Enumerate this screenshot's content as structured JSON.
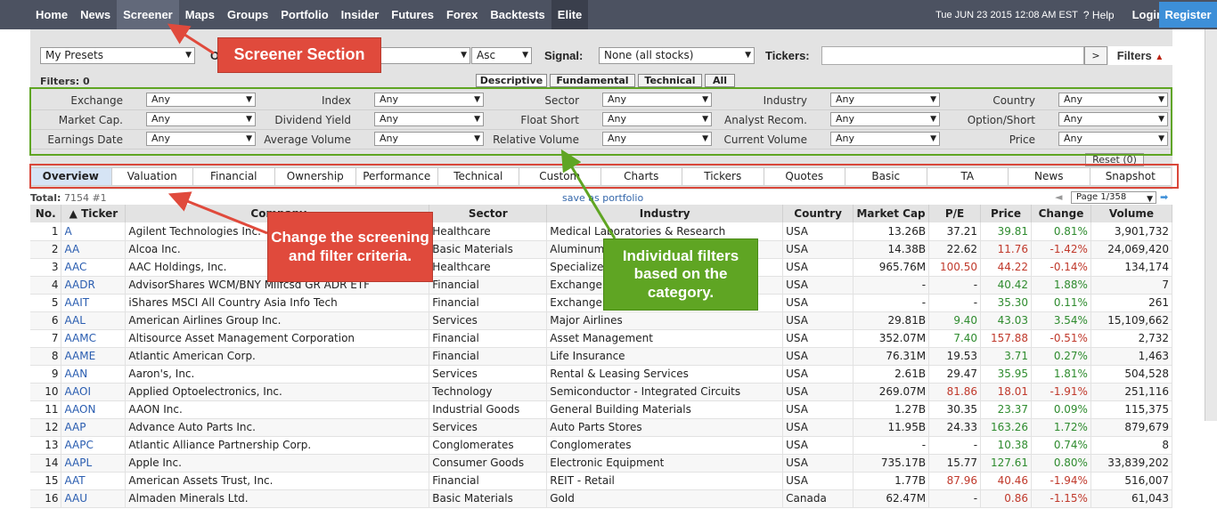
{
  "nav": {
    "items": [
      "Home",
      "News",
      "Screener",
      "Maps",
      "Groups",
      "Portfolio",
      "Insider",
      "Futures",
      "Forex",
      "Backtests",
      "Elite"
    ],
    "active": "Screener",
    "datetime": "Tue JUN 23 2015 12:08 AM EST",
    "help": "Help",
    "login": "Login",
    "register": "Register"
  },
  "controls": {
    "presets": "My Presets",
    "order_label": "O",
    "direction": "Asc",
    "signal_label": "Signal:",
    "signal": "None (all stocks)",
    "tickers_label": "Tickers:",
    "go": ">",
    "filters": "Filters"
  },
  "filters_count": "Filters: 0",
  "filter_tabs": [
    "Descriptive",
    "Fundamental",
    "Technical",
    "All"
  ],
  "filters": [
    {
      "label": "Exchange",
      "value": "Any"
    },
    {
      "label": "Index",
      "value": "Any"
    },
    {
      "label": "Sector",
      "value": "Any"
    },
    {
      "label": "Industry",
      "value": "Any"
    },
    {
      "label": "Country",
      "value": "Any"
    },
    {
      "label": "Market Cap.",
      "value": "Any"
    },
    {
      "label": "Dividend Yield",
      "value": "Any"
    },
    {
      "label": "Float Short",
      "value": "Any"
    },
    {
      "label": "Analyst Recom.",
      "value": "Any"
    },
    {
      "label": "Option/Short",
      "value": "Any"
    },
    {
      "label": "Earnings Date",
      "value": "Any"
    },
    {
      "label": "Average Volume",
      "value": "Any"
    },
    {
      "label": "Relative Volume",
      "value": "Any"
    },
    {
      "label": "Current Volume",
      "value": "Any"
    },
    {
      "label": "Price",
      "value": "Any"
    }
  ],
  "reset": "Reset (0)",
  "view_tabs": [
    "Overview",
    "Valuation",
    "Financial",
    "Ownership",
    "Performance",
    "Technical",
    "Custom",
    "Charts",
    "Tickers",
    "Quotes",
    "Basic",
    "TA",
    "News",
    "Snapshot"
  ],
  "total": {
    "label": "Total:",
    "value": "7154 #1"
  },
  "save_portfolio": "save as portfolio",
  "pager": {
    "prev": "◄",
    "page": "Page 1/358",
    "next": "➡"
  },
  "table": {
    "headers": [
      "No.",
      "▲ Ticker",
      "Company",
      "Sector",
      "Industry",
      "Country",
      "Market Cap",
      "P/E",
      "Price",
      "Change",
      "Volume"
    ],
    "rows": [
      [
        "1",
        "A",
        "Agilent Technologies Inc.",
        "Healthcare",
        "Medical Laboratories & Research",
        "USA",
        "13.26B",
        "37.21",
        "39.81",
        "0.81%",
        "3,901,732"
      ],
      [
        "2",
        "AA",
        "Alcoa Inc.",
        "Basic Materials",
        "Aluminum",
        "USA",
        "14.38B",
        "22.62",
        "11.76",
        "-1.42%",
        "24,069,420"
      ],
      [
        "3",
        "AAC",
        "AAC Holdings, Inc.",
        "Healthcare",
        "Specialized",
        "USA",
        "965.76M",
        "100.50",
        "44.22",
        "-0.14%",
        "134,174"
      ],
      [
        "4",
        "AADR",
        "AdvisorShares WCM/BNY Mllfcsd GR ADR ETF",
        "Financial",
        "Exchange T",
        "USA",
        "-",
        "-",
        "40.42",
        "1.88%",
        "7"
      ],
      [
        "5",
        "AAIT",
        "iShares MSCI All Country Asia Info Tech",
        "Financial",
        "Exchange T",
        "USA",
        "-",
        "-",
        "35.30",
        "0.11%",
        "261"
      ],
      [
        "6",
        "AAL",
        "American Airlines Group Inc.",
        "Services",
        "Major Airlines",
        "USA",
        "29.81B",
        "9.40",
        "43.03",
        "3.54%",
        "15,109,662"
      ],
      [
        "7",
        "AAMC",
        "Altisource Asset Management Corporation",
        "Financial",
        "Asset Management",
        "USA",
        "352.07M",
        "7.40",
        "157.88",
        "-0.51%",
        "2,732"
      ],
      [
        "8",
        "AAME",
        "Atlantic American Corp.",
        "Financial",
        "Life Insurance",
        "USA",
        "76.31M",
        "19.53",
        "3.71",
        "0.27%",
        "1,463"
      ],
      [
        "9",
        "AAN",
        "Aaron's, Inc.",
        "Services",
        "Rental & Leasing Services",
        "USA",
        "2.61B",
        "29.47",
        "35.95",
        "1.81%",
        "504,528"
      ],
      [
        "10",
        "AAOI",
        "Applied Optoelectronics, Inc.",
        "Technology",
        "Semiconductor - Integrated Circuits",
        "USA",
        "269.07M",
        "81.86",
        "18.01",
        "-1.91%",
        "251,116"
      ],
      [
        "11",
        "AAON",
        "AAON Inc.",
        "Industrial Goods",
        "General Building Materials",
        "USA",
        "1.27B",
        "30.35",
        "23.37",
        "0.09%",
        "115,375"
      ],
      [
        "12",
        "AAP",
        "Advance Auto Parts Inc.",
        "Services",
        "Auto Parts Stores",
        "USA",
        "11.95B",
        "24.33",
        "163.26",
        "1.72%",
        "879,679"
      ],
      [
        "13",
        "AAPC",
        "Atlantic Alliance Partnership Corp.",
        "Conglomerates",
        "Conglomerates",
        "USA",
        "-",
        "-",
        "10.38",
        "0.74%",
        "8"
      ],
      [
        "14",
        "AAPL",
        "Apple Inc.",
        "Consumer Goods",
        "Electronic Equipment",
        "USA",
        "735.17B",
        "15.77",
        "127.61",
        "0.80%",
        "33,839,202"
      ],
      [
        "15",
        "AAT",
        "American Assets Trust, Inc.",
        "Financial",
        "REIT - Retail",
        "USA",
        "1.77B",
        "87.96",
        "40.46",
        "-1.94%",
        "516,007"
      ],
      [
        "16",
        "AAU",
        "Almaden Minerals Ltd.",
        "Basic Materials",
        "Gold",
        "Canada",
        "62.47M",
        "-",
        "0.86",
        "-1.15%",
        "61,043"
      ]
    ]
  },
  "annotations": {
    "screener": "Screener Section",
    "change": "Change the screening and filter criteria.",
    "filters": "Individual filters based on the category."
  },
  "colors": {
    "nav_bg": "#4c5261",
    "register": "#3d8fd8",
    "red_note": "#e04a3c",
    "green_note": "#5fa523",
    "positive": "#2e8b2e",
    "negative": "#c0392b"
  }
}
